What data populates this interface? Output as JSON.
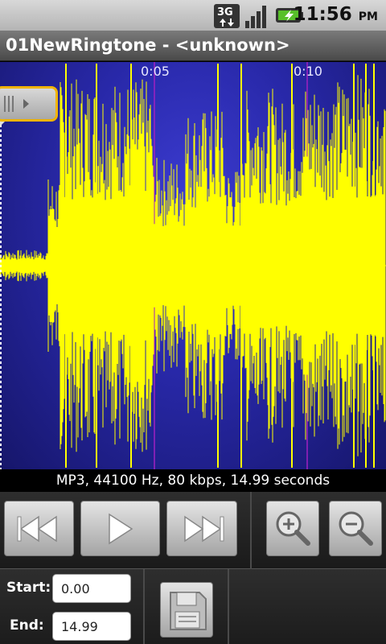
{
  "status_bar": {
    "network_label": "3G",
    "time": "11:56",
    "ampm": "PM",
    "icons": [
      "3g-data-icon",
      "signal-strength-icon",
      "battery-charging-icon"
    ]
  },
  "title_bar": {
    "title": "01NewRingtone - <unknown>"
  },
  "waveform": {
    "time_ticks": [
      "0:05",
      "0:10"
    ],
    "colors": {
      "background": "#2828a8",
      "wave": "#ffff00",
      "gridline": "#a020c0",
      "marker_border": "#f0b400"
    }
  },
  "info_text": "MP3, 44100 Hz, 80 kbps, 14.99 seconds",
  "controls": {
    "rewind": "rewind-icon",
    "play": "play-icon",
    "fast_forward": "fast-forward-icon",
    "zoom_in": "zoom-in-icon",
    "zoom_out": "zoom-out-icon"
  },
  "edit": {
    "start_label": "Start:",
    "start_value": "0.00",
    "end_label": "End:",
    "end_value": "14.99",
    "save": "save-icon"
  }
}
